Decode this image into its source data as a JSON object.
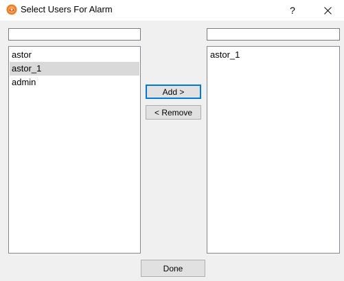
{
  "window": {
    "title": "Select Users For Alarm",
    "help_label": "?",
    "app_icon": "app-icon",
    "close_icon": "close-icon"
  },
  "available_users": {
    "filter_value": "",
    "items": [
      "astor",
      "astor_1",
      "admin"
    ],
    "selected_index": 1
  },
  "assigned_users": {
    "filter_value": "",
    "items": [
      "astor_1"
    ]
  },
  "buttons": {
    "add_label": "Add  >",
    "remove_label": "< Remove",
    "done_label": "Done"
  },
  "colors": {
    "selection": "#d9d9d9",
    "focus_border": "#0078d7",
    "app_icon_orange": "#f07c22"
  }
}
